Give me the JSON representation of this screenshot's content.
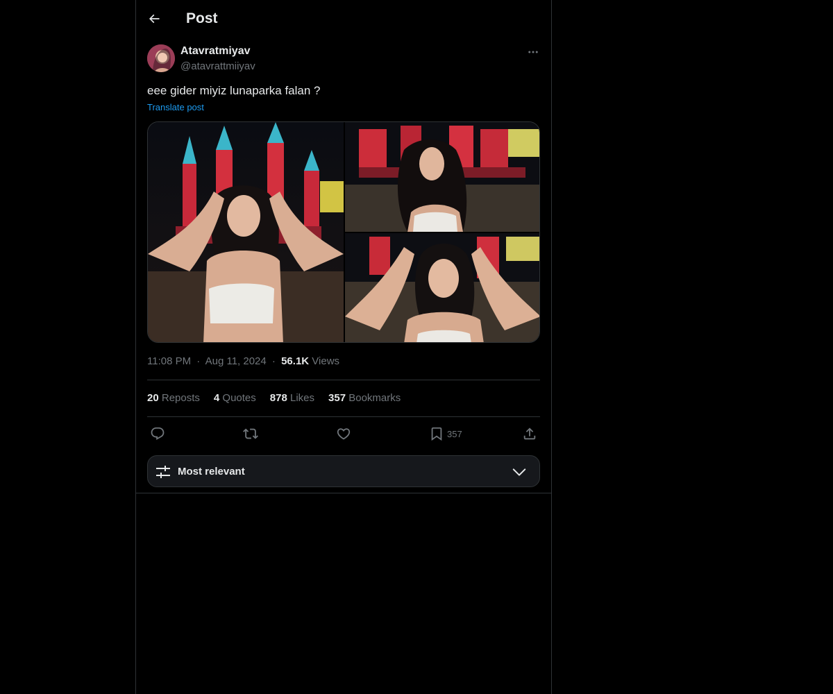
{
  "header": {
    "title": "Post"
  },
  "post": {
    "author": {
      "display_name": "Atavratmiyav",
      "handle": "@atavrattmiiyav"
    },
    "text": "eee gider miyiz lunaparka falan ?",
    "translate_label": "Translate post",
    "media": [
      {
        "icon": "photo",
        "description_icon": "image"
      },
      {
        "icon": "photo",
        "description_icon": "image"
      },
      {
        "icon": "photo",
        "description_icon": "image"
      }
    ],
    "meta": {
      "time": "11:08 PM",
      "date": "Aug 11, 2024",
      "separator": "·",
      "views_count": "56.1K",
      "views_label": "Views"
    },
    "stats": {
      "reposts_count": "20",
      "reposts_label": "Reposts",
      "quotes_count": "4",
      "quotes_label": "Quotes",
      "likes_count": "878",
      "likes_label": "Likes",
      "bookmarks_count": "357",
      "bookmarks_label": "Bookmarks"
    },
    "actions": {
      "reply": {
        "icon": "reply-icon"
      },
      "repost": {
        "icon": "repost-icon"
      },
      "like": {
        "icon": "heart-icon"
      },
      "bookmark": {
        "icon": "bookmark-icon",
        "count": "357"
      },
      "share": {
        "icon": "share-icon"
      }
    }
  },
  "sort": {
    "label": "Most relevant",
    "icon": "sliders-icon"
  },
  "colors": {
    "background": "#000000",
    "text_primary": "#e7e9ea",
    "text_secondary": "#71767b",
    "accent": "#1d9bf0",
    "border": "#2f3336",
    "sort_bg": "#16181c"
  }
}
